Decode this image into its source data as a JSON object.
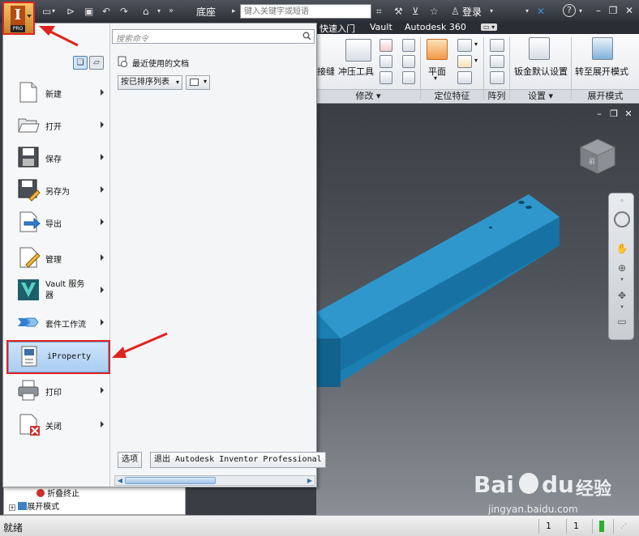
{
  "titlebar": {
    "document_title": "底座",
    "search_placeholder": "键入关键字或短语",
    "login_label": "登录",
    "app_button_badge": "PRO",
    "app_button_letter": "I"
  },
  "ribbon": {
    "tabs": [
      "快速入门",
      "Vault",
      "Autodesk 360"
    ],
    "buttons": {
      "seam": "接缝",
      "punch_tool": "冲压工具",
      "plane": "平面",
      "sheet_metal_defaults": "钣金默认设置",
      "go_to_flat_pattern": "转至展开模式"
    },
    "panels": {
      "modify": "修改",
      "work_features": "定位特征",
      "pattern": "阵列",
      "setup": "设置",
      "flat_pattern": "展开模式"
    }
  },
  "app_menu": {
    "items": [
      {
        "label": "新建"
      },
      {
        "label": "打开"
      },
      {
        "label": "保存"
      },
      {
        "label": "另存为"
      },
      {
        "label": "导出"
      },
      {
        "label": "管理"
      },
      {
        "label": "Vault 服务器"
      },
      {
        "label": "套件工作流"
      },
      {
        "label": "iProperty"
      },
      {
        "label": "打印"
      },
      {
        "label": "关闭"
      }
    ],
    "search_placeholder": "搜索命令",
    "recent_docs_title": "最近使用的文档",
    "sort_dropdown": "按已排序列表",
    "options_button": "选项",
    "exit_button": "退出 Autodesk Inventor Professional"
  },
  "browser": {
    "rows": [
      "折叠终止",
      "展开模式"
    ]
  },
  "statusbar": {
    "status": "就绪",
    "cell1": "1",
    "cell2": "1"
  },
  "viewcube": {
    "face_label": "前"
  },
  "watermark": {
    "brand": "Bai",
    "brand2": "du",
    "cn": "经验",
    "url": "jingyan.baidu.com"
  },
  "colors": {
    "highlight_border": "#e0231e",
    "model_blue": "#1b7fb3",
    "highlight_fill": "#b9d8f6"
  }
}
